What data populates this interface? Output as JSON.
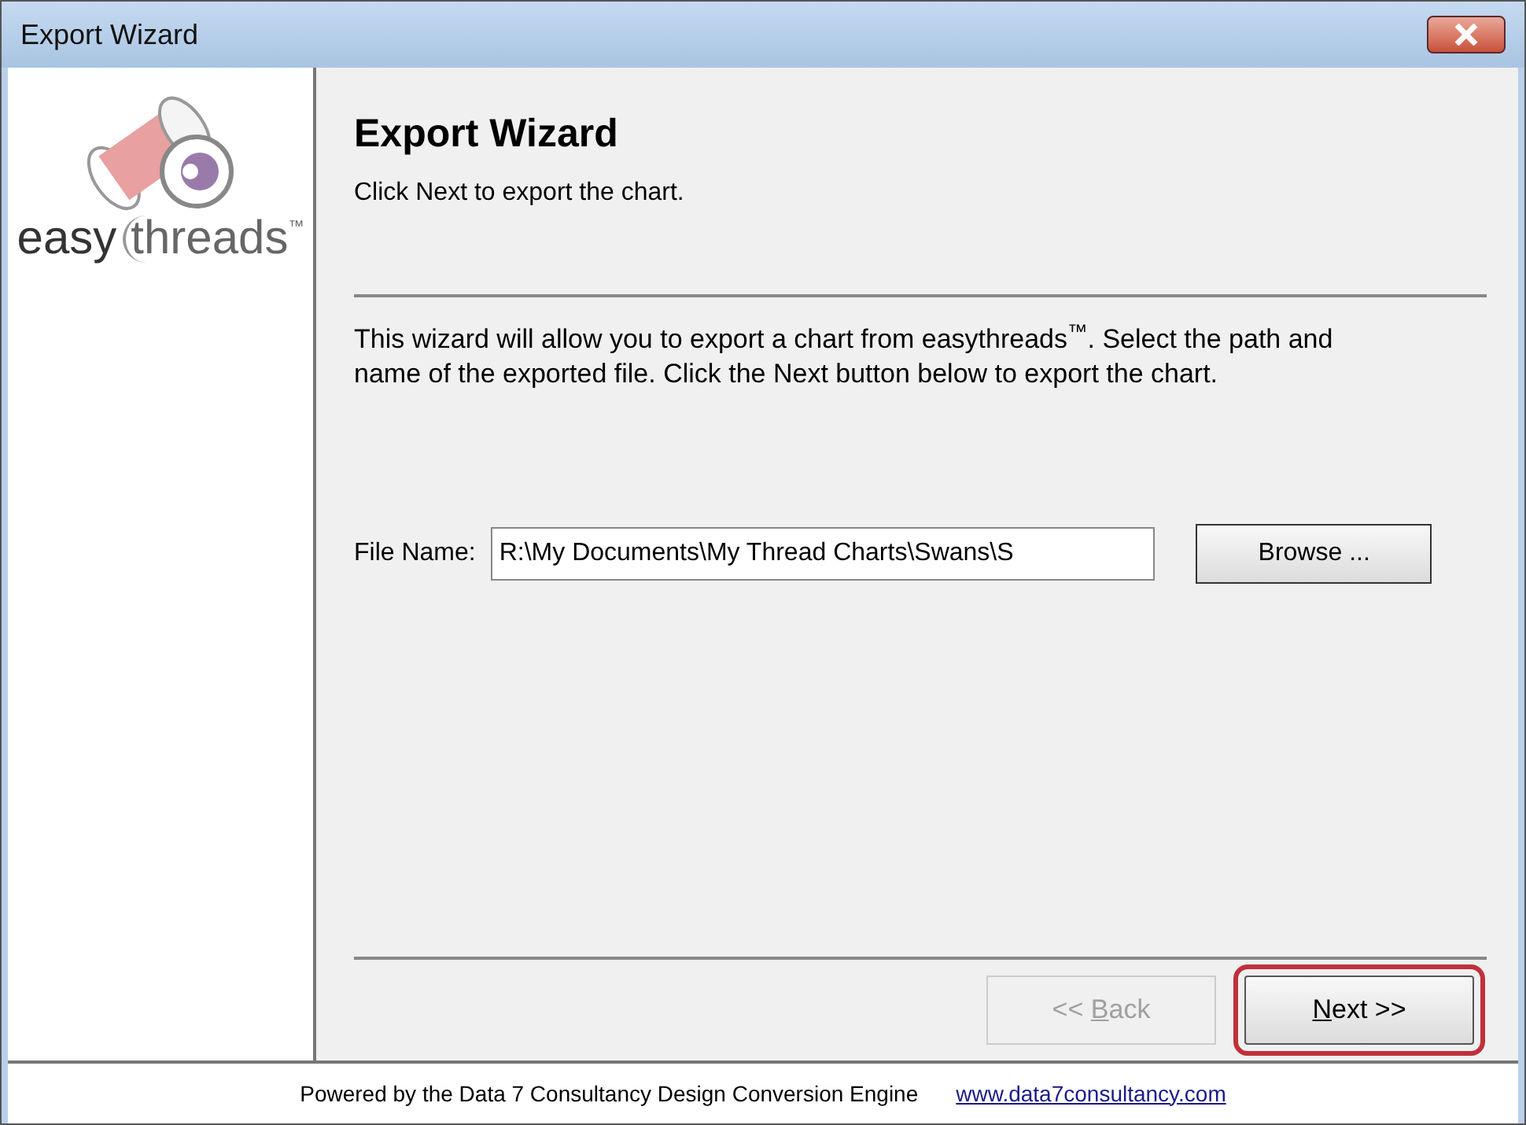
{
  "window": {
    "title": "Export Wizard"
  },
  "logo": {
    "word_1": "easy",
    "word_2": "threads",
    "mark": "™"
  },
  "header": {
    "title": "Export Wizard",
    "subtitle": "Click Next to export the chart."
  },
  "description": "This wizard will allow you to export a chart from easythreads$^{™}$. Select the path and name of the exported file.  Click the Next button below to export the chart.",
  "file_name": {
    "label": "File Name:",
    "value": "R:\\My Documents\\My Thread Charts\\Swans\\S"
  },
  "browse_button": "Browse ...",
  "buttons": [
    {
      "prefix": "<< ",
      "mnemonic": "B",
      "suffix": "ack",
      "disabled": true,
      "highlighted": false
    },
    {
      "mnemonic": "N",
      "suffix": "ext >>",
      "disabled": false,
      "highlighted": true
    }
  ],
  "footer": {
    "text": "Powered by the Data 7 Consultancy Design Conversion Engine",
    "link": "www.data7consultancy.com"
  }
}
